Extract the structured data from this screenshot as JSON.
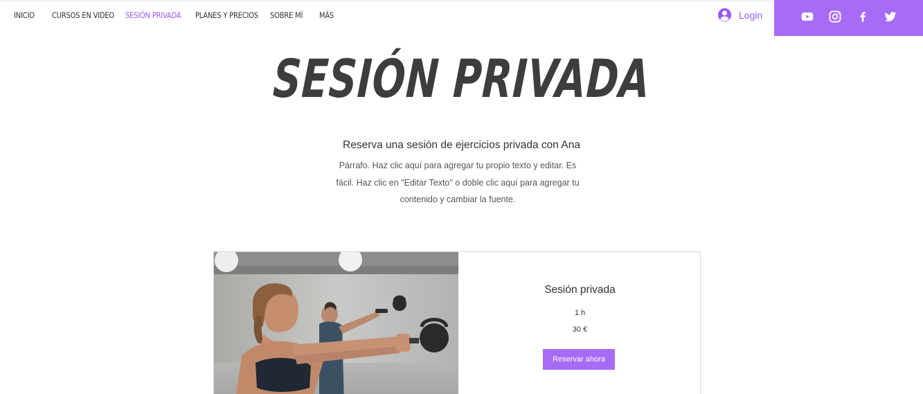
{
  "nav": {
    "items": [
      {
        "label": "INICIO",
        "active": false
      },
      {
        "label": "CURSOS EN VIDEO",
        "active": false
      },
      {
        "label": "SESIÓN PRIVADA",
        "active": true
      },
      {
        "label": "PLANES Y PRECIOS",
        "active": false
      },
      {
        "label": "SOBRE MÍ",
        "active": false
      },
      {
        "label": "MÁS",
        "active": false
      }
    ],
    "login_label": "Login",
    "login_icon": "user-avatar-icon"
  },
  "social": {
    "icons": [
      "youtube-icon",
      "instagram-icon",
      "facebook-icon",
      "twitter-icon"
    ]
  },
  "hero": {
    "title": "SESIÓN PRIVADA",
    "subtitle": "Reserva una sesión de ejercicios privada con Ana",
    "paragraph_lines": [
      "Párrafo. Haz clic aquí para agregar tu propio texto y editar. Es",
      "fácil. Haz clic en \"Editar Texto\" o doble clic aquí para agregar tu",
      "contenido y cambiar la fuente."
    ]
  },
  "service": {
    "name": "Sesión privada",
    "duration": "1 h",
    "price": "30 €",
    "button_label": "Reservar ahora"
  },
  "colors": {
    "accent": "#9b59f5",
    "social_bar": "#a76cf5",
    "title": "#3d3d3d"
  }
}
